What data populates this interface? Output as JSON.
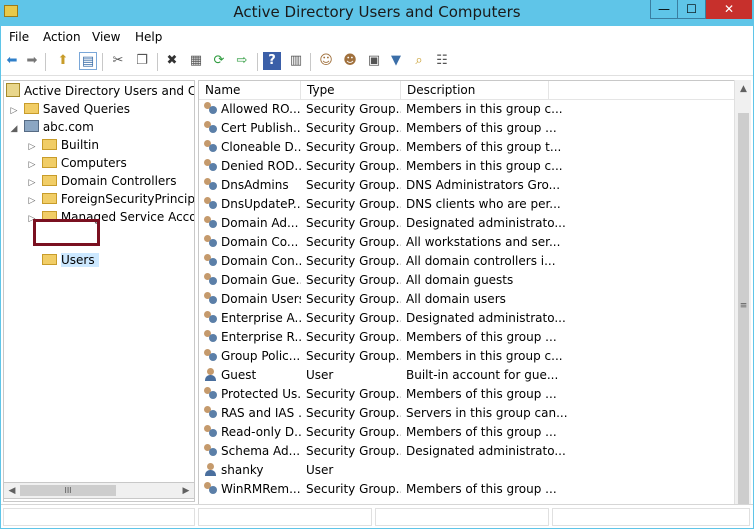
{
  "window": {
    "title": "Active Directory Users and Computers"
  },
  "title_buttons": {
    "minimize": "—",
    "maximize": "☐",
    "close": "✕"
  },
  "menu": {
    "items": [
      "File",
      "Action",
      "View",
      "Help"
    ]
  },
  "toolbar": {
    "icons": [
      "back-arrow-icon",
      "forward-arrow-icon",
      "up-folder-icon",
      "show-tree-icon",
      "cut-icon",
      "copy-icon",
      "delete-icon",
      "properties-icon",
      "refresh-icon",
      "export-list-icon",
      "help-icon",
      "console-icon",
      "new-user-icon",
      "new-group-icon",
      "new-ou-icon",
      "filter-icon",
      "find-icon",
      "add-to-group-icon"
    ],
    "glyphs": [
      "⬅",
      "➡",
      "⬆",
      "▤",
      "✂",
      "❐",
      "✖",
      "▦",
      "⟳",
      "⇨",
      "?",
      "▥",
      "☺",
      "☻",
      "▣",
      "▼",
      "⌕",
      "☷"
    ]
  },
  "tree": {
    "root": "Active Directory Users and Computers [WIN-DC.abc.com]",
    "saved_queries": "Saved Queries",
    "domain": "abc.com",
    "children": [
      "Builtin",
      "Computers",
      "Domain Controllers",
      "ForeignSecurityPrincipals",
      "Managed Service Accounts",
      "Users"
    ]
  },
  "list": {
    "columns": [
      "Name",
      "Type",
      "Description"
    ],
    "rows": [
      {
        "icon": "group",
        "name": "Allowed RO...",
        "type": "Security Group...",
        "description": "Members in this group c..."
      },
      {
        "icon": "group",
        "name": "Cert Publish...",
        "type": "Security Group...",
        "description": "Members of this group ..."
      },
      {
        "icon": "group",
        "name": "Cloneable D...",
        "type": "Security Group...",
        "description": "Members of this group t..."
      },
      {
        "icon": "group",
        "name": "Denied ROD...",
        "type": "Security Group...",
        "description": "Members in this group c..."
      },
      {
        "icon": "group",
        "name": "DnsAdmins",
        "type": "Security Group...",
        "description": "DNS Administrators Gro..."
      },
      {
        "icon": "group",
        "name": "DnsUpdateP...",
        "type": "Security Group...",
        "description": "DNS clients who are per..."
      },
      {
        "icon": "group",
        "name": "Domain Ad...",
        "type": "Security Group...",
        "description": "Designated administrato..."
      },
      {
        "icon": "group",
        "name": "Domain Co...",
        "type": "Security Group...",
        "description": "All workstations and ser..."
      },
      {
        "icon": "group",
        "name": "Domain Con...",
        "type": "Security Group...",
        "description": "All domain controllers i..."
      },
      {
        "icon": "group",
        "name": "Domain Gue...",
        "type": "Security Group...",
        "description": "All domain guests"
      },
      {
        "icon": "group",
        "name": "Domain Users",
        "type": "Security Group...",
        "description": "All domain users"
      },
      {
        "icon": "group",
        "name": "Enterprise A...",
        "type": "Security Group...",
        "description": "Designated administrato..."
      },
      {
        "icon": "group",
        "name": "Enterprise R...",
        "type": "Security Group...",
        "description": "Members of this group ..."
      },
      {
        "icon": "group",
        "name": "Group Polic...",
        "type": "Security Group...",
        "description": "Members in this group c..."
      },
      {
        "icon": "user",
        "name": "Guest",
        "type": "User",
        "description": "Built-in account for gue..."
      },
      {
        "icon": "group",
        "name": "Protected Us...",
        "type": "Security Group...",
        "description": "Members of this group ..."
      },
      {
        "icon": "group",
        "name": "RAS and IAS ...",
        "type": "Security Group...",
        "description": "Servers in this group can..."
      },
      {
        "icon": "group",
        "name": "Read-only D...",
        "type": "Security Group...",
        "description": "Members of this group ..."
      },
      {
        "icon": "group",
        "name": "Schema Ad...",
        "type": "Security Group...",
        "description": "Designated administrato..."
      },
      {
        "icon": "user",
        "name": "shanky",
        "type": "User",
        "description": ""
      },
      {
        "icon": "group",
        "name": "WinRMRem...",
        "type": "Security Group...",
        "description": "Members of this group ..."
      }
    ]
  },
  "scroll": {
    "grip": "III",
    "vgrip": "≡",
    "left": "◀",
    "right": "▶",
    "up": "▲",
    "down": "▼"
  },
  "colors": {
    "title_bg": "#5fc5e8",
    "close_btn": "#c7302c",
    "highlight_border": "#7a1020"
  }
}
